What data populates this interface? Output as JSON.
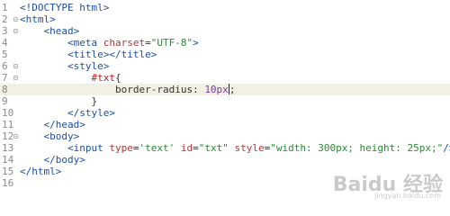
{
  "lines": [
    {
      "num": "1",
      "fold": "",
      "indent": "",
      "parts": [
        {
          "c": "tag",
          "t": "<!DOCTYPE html>"
        }
      ]
    },
    {
      "num": "2",
      "fold": "⊟",
      "indent": "",
      "parts": [
        {
          "c": "tag",
          "t": "<html>"
        }
      ]
    },
    {
      "num": "3",
      "fold": "⊟",
      "indent": "    ",
      "parts": [
        {
          "c": "tag",
          "t": "<head>"
        }
      ]
    },
    {
      "num": "4",
      "fold": "",
      "indent": "        ",
      "parts": [
        {
          "c": "tag",
          "t": "<meta "
        },
        {
          "c": "attr",
          "t": "charset"
        },
        {
          "c": "plain",
          "t": "="
        },
        {
          "c": "str",
          "t": "\"UTF-8\""
        },
        {
          "c": "tag",
          "t": ">"
        }
      ]
    },
    {
      "num": "5",
      "fold": "",
      "indent": "        ",
      "parts": [
        {
          "c": "tag",
          "t": "<title></title>"
        }
      ]
    },
    {
      "num": "6",
      "fold": "⊟",
      "indent": "        ",
      "parts": [
        {
          "c": "tag",
          "t": "<style>"
        }
      ]
    },
    {
      "num": "7",
      "fold": "⊟",
      "indent": "            ",
      "parts": [
        {
          "c": "sel",
          "t": "#txt"
        },
        {
          "c": "plain",
          "t": "{"
        }
      ]
    },
    {
      "num": "8",
      "fold": "",
      "indent": "                ",
      "parts": [
        {
          "c": "prop",
          "t": "border-radius"
        },
        {
          "c": "plain",
          "t": ": "
        },
        {
          "c": "num",
          "t": "10px"
        },
        {
          "c": "caret",
          "t": ""
        },
        {
          "c": "plain",
          "t": ";"
        }
      ]
    },
    {
      "num": "9",
      "fold": "",
      "indent": "            ",
      "parts": [
        {
          "c": "plain",
          "t": "}"
        }
      ]
    },
    {
      "num": "10",
      "fold": "",
      "indent": "        ",
      "parts": [
        {
          "c": "tag",
          "t": "</style>"
        }
      ]
    },
    {
      "num": "11",
      "fold": "",
      "indent": "    ",
      "parts": [
        {
          "c": "tag",
          "t": "</head>"
        }
      ]
    },
    {
      "num": "12",
      "fold": "⊟",
      "indent": "    ",
      "parts": [
        {
          "c": "tag",
          "t": "<body>"
        }
      ]
    },
    {
      "num": "13",
      "fold": "",
      "indent": "        ",
      "parts": [
        {
          "c": "tag",
          "t": "<input "
        },
        {
          "c": "attr",
          "t": "type"
        },
        {
          "c": "plain",
          "t": "="
        },
        {
          "c": "str",
          "t": "'text'"
        },
        {
          "c": "plain",
          "t": " "
        },
        {
          "c": "attr",
          "t": "id"
        },
        {
          "c": "plain",
          "t": "="
        },
        {
          "c": "str",
          "t": "\"txt\""
        },
        {
          "c": "plain",
          "t": " "
        },
        {
          "c": "attr",
          "t": "style"
        },
        {
          "c": "plain",
          "t": "="
        },
        {
          "c": "str",
          "t": "\"width: 300px; height: 25px;\""
        },
        {
          "c": "tag",
          "t": "/>"
        }
      ]
    },
    {
      "num": "14",
      "fold": "",
      "indent": "    ",
      "parts": [
        {
          "c": "tag",
          "t": "</body>"
        }
      ]
    },
    {
      "num": "15",
      "fold": "",
      "indent": "",
      "parts": [
        {
          "c": "tag",
          "t": "</html>"
        }
      ]
    },
    {
      "num": "16",
      "fold": "",
      "indent": "",
      "parts": []
    }
  ],
  "highlighted_line": "8",
  "watermark": {
    "main": "Baidu 经验",
    "sub": "jingyan.baidu.com"
  }
}
